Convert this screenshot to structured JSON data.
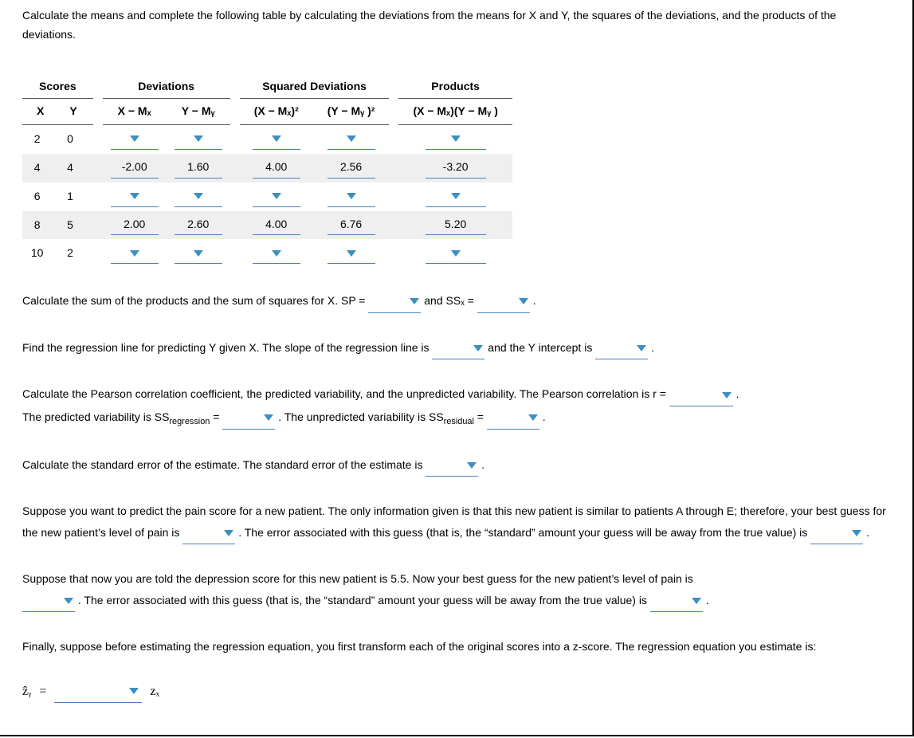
{
  "intro": "Calculate the means and complete the following table by calculating the deviations from the means for X and Y, the squares of the deviations, and the products of the deviations.",
  "table": {
    "group_headers": {
      "scores": "Scores",
      "deviations": "Deviations",
      "sqdev": "Squared Deviations",
      "products": "Products"
    },
    "col_headers": {
      "x": "X",
      "y": "Y",
      "xmx": "X − Mₓ",
      "ymy": "Y − Mᵧ",
      "xmx2": "(X − Mₓ)²",
      "ymy2": "(Y − Mᵧ )²",
      "prod": "(X − Mₓ)(Y − Mᵧ )"
    },
    "rows": [
      {
        "x": "2",
        "y": "0",
        "xmx": "",
        "ymy": "",
        "xmx2": "",
        "ymy2": "",
        "prod": ""
      },
      {
        "x": "4",
        "y": "4",
        "xmx": "-2.00",
        "ymy": "1.60",
        "xmx2": "4.00",
        "ymy2": "2.56",
        "prod": "-3.20"
      },
      {
        "x": "6",
        "y": "1",
        "xmx": "",
        "ymy": "",
        "xmx2": "",
        "ymy2": "",
        "prod": ""
      },
      {
        "x": "8",
        "y": "5",
        "xmx": "2.00",
        "ymy": "2.60",
        "xmx2": "4.00",
        "ymy2": "6.76",
        "prod": "5.20"
      },
      {
        "x": "10",
        "y": "2",
        "xmx": "",
        "ymy": "",
        "xmx2": "",
        "ymy2": "",
        "prod": ""
      }
    ]
  },
  "q1": {
    "pre": "Calculate the sum of the products and the sum of squares for X. SP = ",
    "mid": " and SSₓ = ",
    "end": " ."
  },
  "q2": {
    "pre": "Find the regression line for predicting Y given X. The slope of the regression line is ",
    "mid": " and the Y intercept is ",
    "end": " ."
  },
  "q3": {
    "line1_pre": "Calculate the Pearson correlation coefficient, the predicted variability, and the unpredicted variability. The Pearson correlation is r = ",
    "line1_end": " .",
    "line2_pre": "The predicted variability is SS",
    "line2_sub": "regression",
    "line2_mid": " = ",
    "line2_mid2": " . The unpredicted variability is SS",
    "line2_sub2": "residual",
    "line2_mid3": " = ",
    "line2_end": " ."
  },
  "q4": {
    "pre": "Calculate the standard error of the estimate. The standard error of the estimate is ",
    "end": " ."
  },
  "q5": {
    "a": "Suppose you want to predict the pain score for a new patient. The only information given is that this new patient is similar to patients A through E; therefore, your best guess for the new patient’s level of pain is ",
    "b": " . The error associated with this guess (that is, the “standard” amount your guess will be away from the true value) is ",
    "c": " ."
  },
  "q6": {
    "a": "Suppose that now you are told the depression score for this new patient is 5.5. Now your best guess for the new patient’s level of pain is ",
    "b": " . The error associated with this guess (that is, the “standard” amount your guess will be away from the true value) is ",
    "c": " ."
  },
  "q7": "Finally, suppose before estimating the regression equation, you first transform each of the original scores into a z-score. The regression equation you estimate is:",
  "eq": {
    "lhs": "ẑᵧ",
    "eq": "=",
    "rhs": "zₓ"
  }
}
